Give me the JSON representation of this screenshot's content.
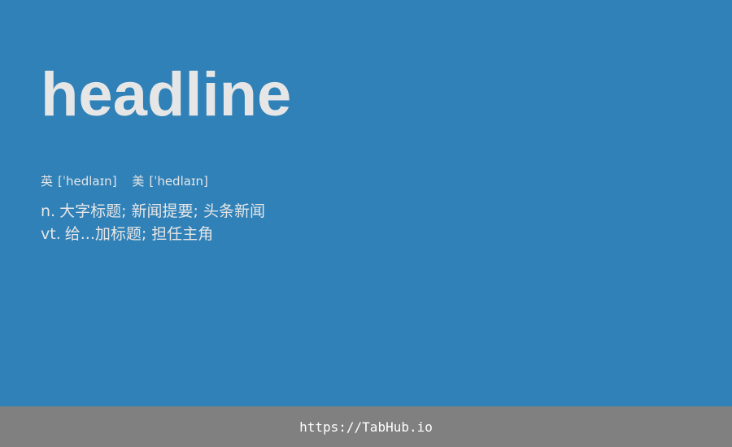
{
  "word": "headline",
  "pronunciations": [
    {
      "label": "英",
      "ipa": "[ˈhedlaɪn]"
    },
    {
      "label": "美",
      "ipa": "[ˈhedlaɪn]"
    }
  ],
  "definitions": [
    {
      "pos": "n.",
      "meaning": "大字标题; 新闻提要; 头条新闻"
    },
    {
      "pos": "vt.",
      "meaning": "给...加标题; 担任主角"
    }
  ],
  "footer": {
    "link": "https://TabHub.io"
  },
  "colors": {
    "background": "#2f81b8",
    "text": "#e6e6e6",
    "footer_bg": "#808080",
    "footer_text": "#ffffff"
  }
}
